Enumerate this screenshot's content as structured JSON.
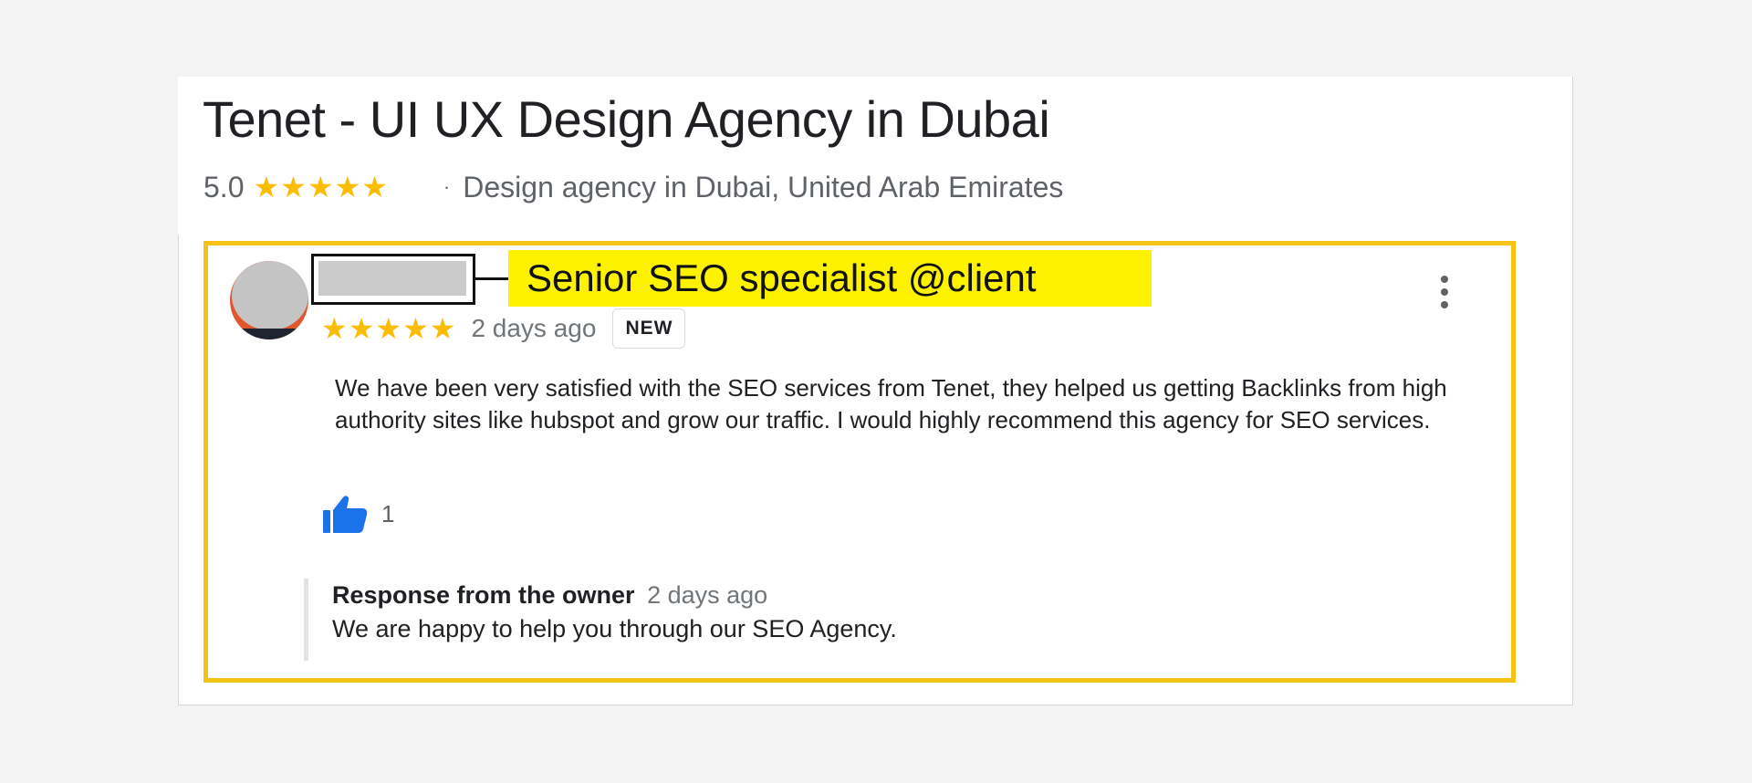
{
  "business": {
    "title": "Tenet - UI UX Design Agency in Dubai",
    "rating": "5.0",
    "stars": "★★★★★",
    "separator": "·",
    "category": "Design agency in Dubai, United Arab Emirates"
  },
  "review": {
    "annotation": "Senior SEO specialist @client",
    "stars": "★★★★★",
    "rating_value": 5,
    "time": "2 days ago",
    "badge": "NEW",
    "text": "We have been very satisfied with the SEO services from Tenet, they helped us getting Backlinks from high authority sites like hubspot and grow our traffic. I would highly recommend this agency for SEO services.",
    "likes": "1",
    "more_icon": "more-vert-icon",
    "like_icon": "thumbs-up-icon"
  },
  "response": {
    "label": "Response from the owner",
    "time": "2 days ago",
    "text": "We are happy to help you through our SEO Agency."
  },
  "colors": {
    "star": "#fbbc04",
    "highlight_border": "#f6c315",
    "annotation_bg": "#fff200",
    "like_icon": "#1a73e8"
  }
}
